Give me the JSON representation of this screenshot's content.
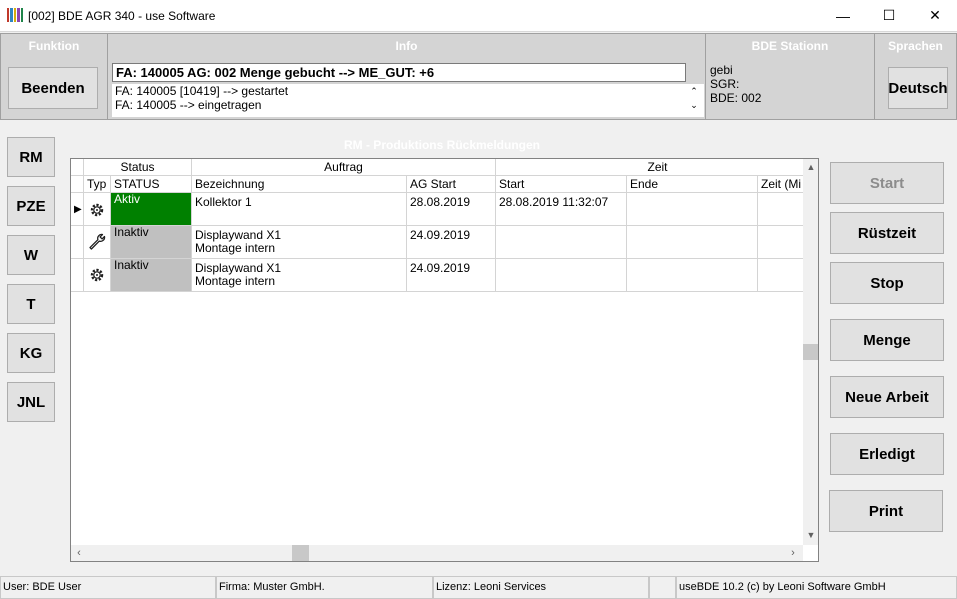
{
  "window": {
    "title": "[002] BDE AGR 340 - use Software",
    "minimize": "—",
    "maximize": "☐",
    "close": "✕"
  },
  "header": {
    "funktion": {
      "title": "Funktion",
      "button": "Beenden"
    },
    "info": {
      "title": "Info",
      "main_message": "FA: 140005 AG: 002 Menge gebucht --> ME_GUT: +6",
      "log": [
        "FA: 140005 [10419] --> gestartet",
        "FA: 140005 --> eingetragen"
      ],
      "scroll_up": "⌃",
      "scroll_down": "⌄"
    },
    "station": {
      "title": "BDE Stationn",
      "lines": [
        "gebi",
        "SGR:",
        "BDE: 002"
      ]
    },
    "sprachen": {
      "title": "Sprachen",
      "button": "Deutsch"
    }
  },
  "sidebar": {
    "items": [
      "RM",
      "PZE",
      "W",
      "T",
      "KG",
      "JNL"
    ]
  },
  "main": {
    "title": "RM - Produktions Rückmeldungen",
    "grid": {
      "group_headers": [
        "Status",
        "Auftrag",
        "Zeit"
      ],
      "columns": [
        "Typ",
        "STATUS",
        "Bezeichnung",
        "AG Start",
        "Start",
        "Ende",
        "Zeit (Mi"
      ],
      "rows": [
        {
          "current": true,
          "typ_icon": "gear-icon",
          "status": "Aktiv",
          "status_color": "#008000",
          "bez1": "Kollektor 1",
          "bez2": "",
          "ag_start": "28.08.2019",
          "start": "28.08.2019 11:32:07",
          "ende": "",
          "zeit": ""
        },
        {
          "current": false,
          "typ_icon": "wrench-icon",
          "status": "Inaktiv",
          "status_color": "#c0c0c0",
          "bez1": "Displaywand X1",
          "bez2": "Montage intern",
          "ag_start": "24.09.2019",
          "start": "",
          "ende": "",
          "zeit": ""
        },
        {
          "current": false,
          "typ_icon": "gear-icon",
          "status": "Inaktiv",
          "status_color": "#c0c0c0",
          "bez1": "Displaywand X1",
          "bez2": "Montage intern",
          "ag_start": "24.09.2019",
          "start": "",
          "ende": "",
          "zeit": ""
        }
      ]
    }
  },
  "actions": {
    "start": "Start",
    "ruestzeit": "Rüstzeit",
    "stop": "Stop",
    "menge": "Menge",
    "neue_arbeit": "Neue Arbeit",
    "erledigt": "Erledigt",
    "print": "Print"
  },
  "statusbar": {
    "user": "User: BDE User",
    "firma": "Firma: Muster GmbH.",
    "lizenz": "Lizenz: Leoni Services",
    "empty": "",
    "version": "useBDE 10.2 (c) by Leoni Software GmbH"
  }
}
